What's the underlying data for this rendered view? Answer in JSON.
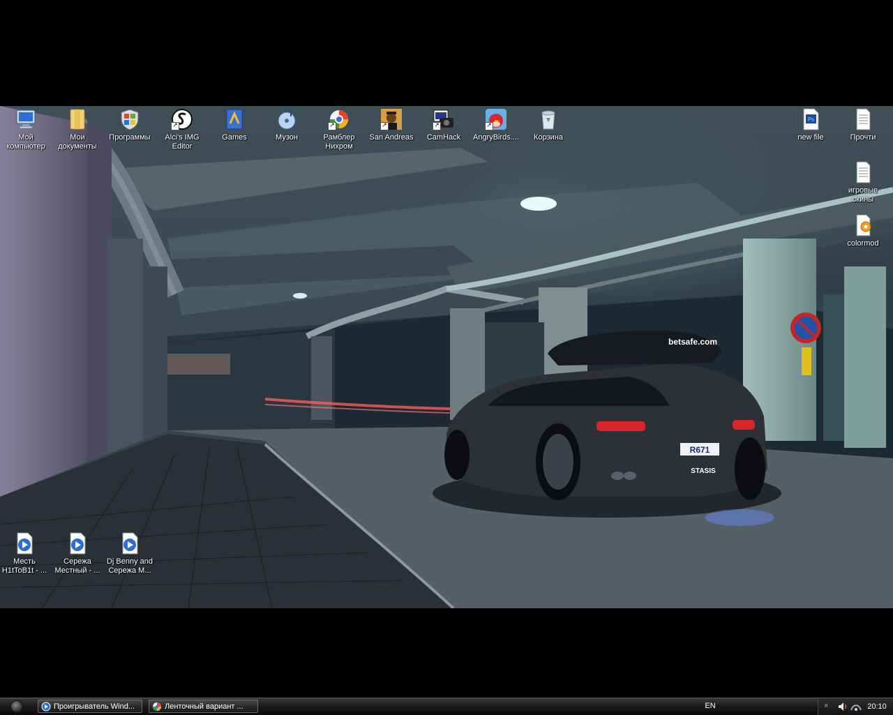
{
  "desktop": {
    "icons_top": [
      {
        "label": "Мой компьютер"
      },
      {
        "label": "Мои документы"
      },
      {
        "label": "Программы"
      },
      {
        "label": "Alci's IMG Editor"
      },
      {
        "label": "Games"
      },
      {
        "label": "Музон"
      },
      {
        "label": "Рамблер Нихром"
      },
      {
        "label": "San Andreas"
      },
      {
        "label": "CamHack"
      },
      {
        "label": "AngryBirds...."
      },
      {
        "label": "Корзина"
      }
    ],
    "icons_right": [
      {
        "label": "new file"
      },
      {
        "label": "Прочти"
      },
      {
        "label": "игровые скины"
      },
      {
        "label": "colormod"
      }
    ],
    "icons_bottom": [
      {
        "label": "Месть H1tToB1t - ..."
      },
      {
        "label": "Сережа Местный - ..."
      },
      {
        "label": "Dj Benny and Сережа М..."
      }
    ],
    "wallpaper": {
      "plate_text": "R671",
      "roofbox_text": "betsafe.com",
      "badge_text": "STASIS"
    }
  },
  "taskbar": {
    "tasks": [
      {
        "label": "Проигрыватель Wind..."
      },
      {
        "label": "Ленточный вариант ..."
      }
    ],
    "language": "EN",
    "clock": "20:10",
    "tray_collapse": "×"
  },
  "colors": {
    "taskbar_bg": "#1b1b1b",
    "desktop_label": "#ffffff",
    "wallpaper_tone": "#2e3a44"
  }
}
